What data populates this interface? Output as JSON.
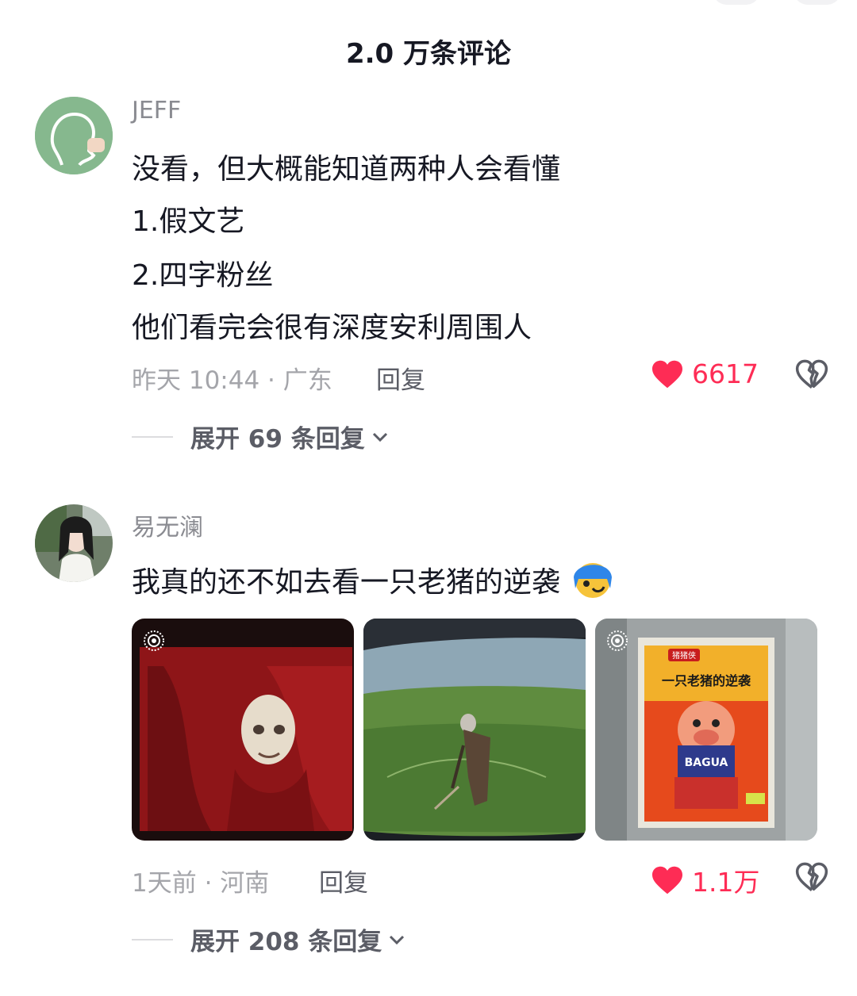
{
  "header": {
    "title": "2.0 万条评论"
  },
  "comments": [
    {
      "username": "JEFF",
      "lines": [
        "没看，但大概能知道两种人会看懂",
        "1.假文艺",
        "2.四字粉丝",
        "他们看完会很有深度安利周围人"
      ],
      "time_location": "昨天 10:44 · 广东",
      "reply_label": "回复",
      "likes": "6617",
      "expand_label": "展开 69 条回复"
    },
    {
      "username": "易无澜",
      "lines": [
        "我真的还不如去看一只老猪的逆袭"
      ],
      "time_location": "1天前 · 河南",
      "reply_label": "回复",
      "likes": "1.1万",
      "expand_label": "展开 208 条回复",
      "images": [
        {
          "description": "red-curtain-mask",
          "live": true
        },
        {
          "description": "field-old-man",
          "live": false
        },
        {
          "description": "movie-poster",
          "live": true,
          "poster_title": "一只老猪的逆袭",
          "poster_brand": "猪猪侠",
          "magazine_text": "BAGUA"
        }
      ]
    }
  ],
  "colors": {
    "like_red": "#fe2c55",
    "text": "#161823",
    "meta": "#a4a5aa"
  }
}
